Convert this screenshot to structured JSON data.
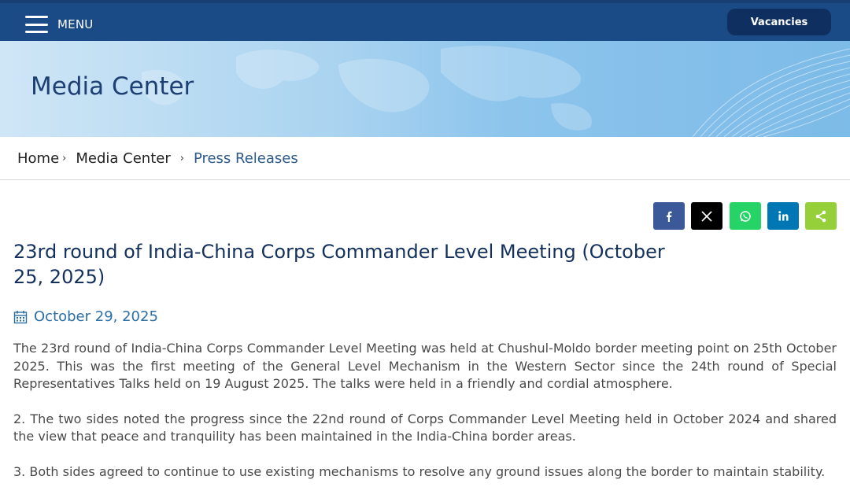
{
  "header": {
    "menu_label": "MENU",
    "vacancies_label": "Vacancies",
    "bg_color": "#1b4b86"
  },
  "banner": {
    "title": "Media Center"
  },
  "breadcrumb": {
    "items": [
      "Home",
      "Media Center",
      "Press Releases"
    ],
    "separator": "›"
  },
  "share": {
    "buttons": [
      {
        "name": "facebook",
        "icon": "facebook-icon",
        "color": "#3b5998"
      },
      {
        "name": "twitter",
        "icon": "x-icon",
        "color": "#000000"
      },
      {
        "name": "whatsapp",
        "icon": "whatsapp-icon",
        "color": "#25d366"
      },
      {
        "name": "linkedin",
        "icon": "linkedin-icon",
        "color": "#0077b5"
      },
      {
        "name": "sharethis",
        "icon": "share-icon",
        "color": "#95d03a"
      }
    ]
  },
  "article": {
    "title": "23rd round of India-China Corps Commander Level Meeting (October 25, 2025)",
    "date": "October 29, 2025",
    "paragraphs": [
      "The 23rd round of India-China Corps Commander Level Meeting was held at Chushul-Moldo border meeting point on 25th October 2025. This was the first meeting of the General Level Mechanism in the Western Sector since the 24th round of Special Representatives Talks held on 19 August 2025. The talks were held in a friendly and cordial atmosphere.",
      "2. The two sides noted the progress since the 22nd round of Corps Commander Level Meeting held in October 2024 and shared the view that peace and tranquility has been maintained in the India-China border areas.",
      "3. Both sides agreed to continue to use existing mechanisms to resolve any ground issues along the border to maintain stability."
    ]
  }
}
